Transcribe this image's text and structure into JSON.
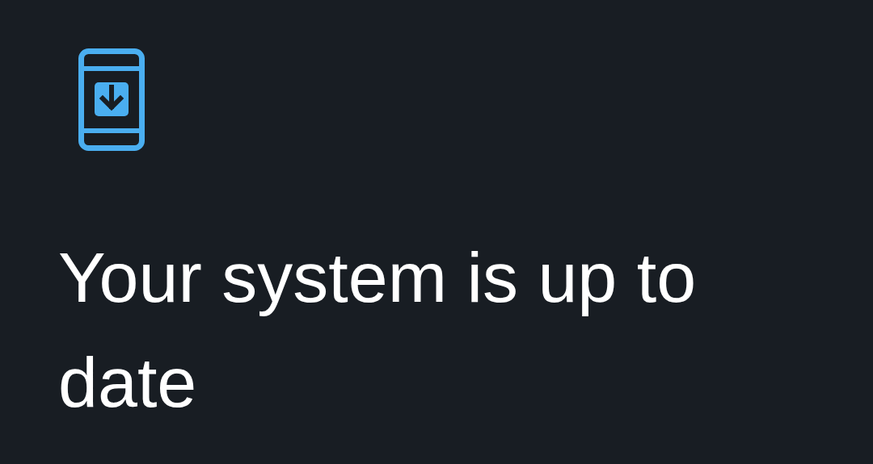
{
  "status": {
    "title": "Your system is up to date"
  }
}
